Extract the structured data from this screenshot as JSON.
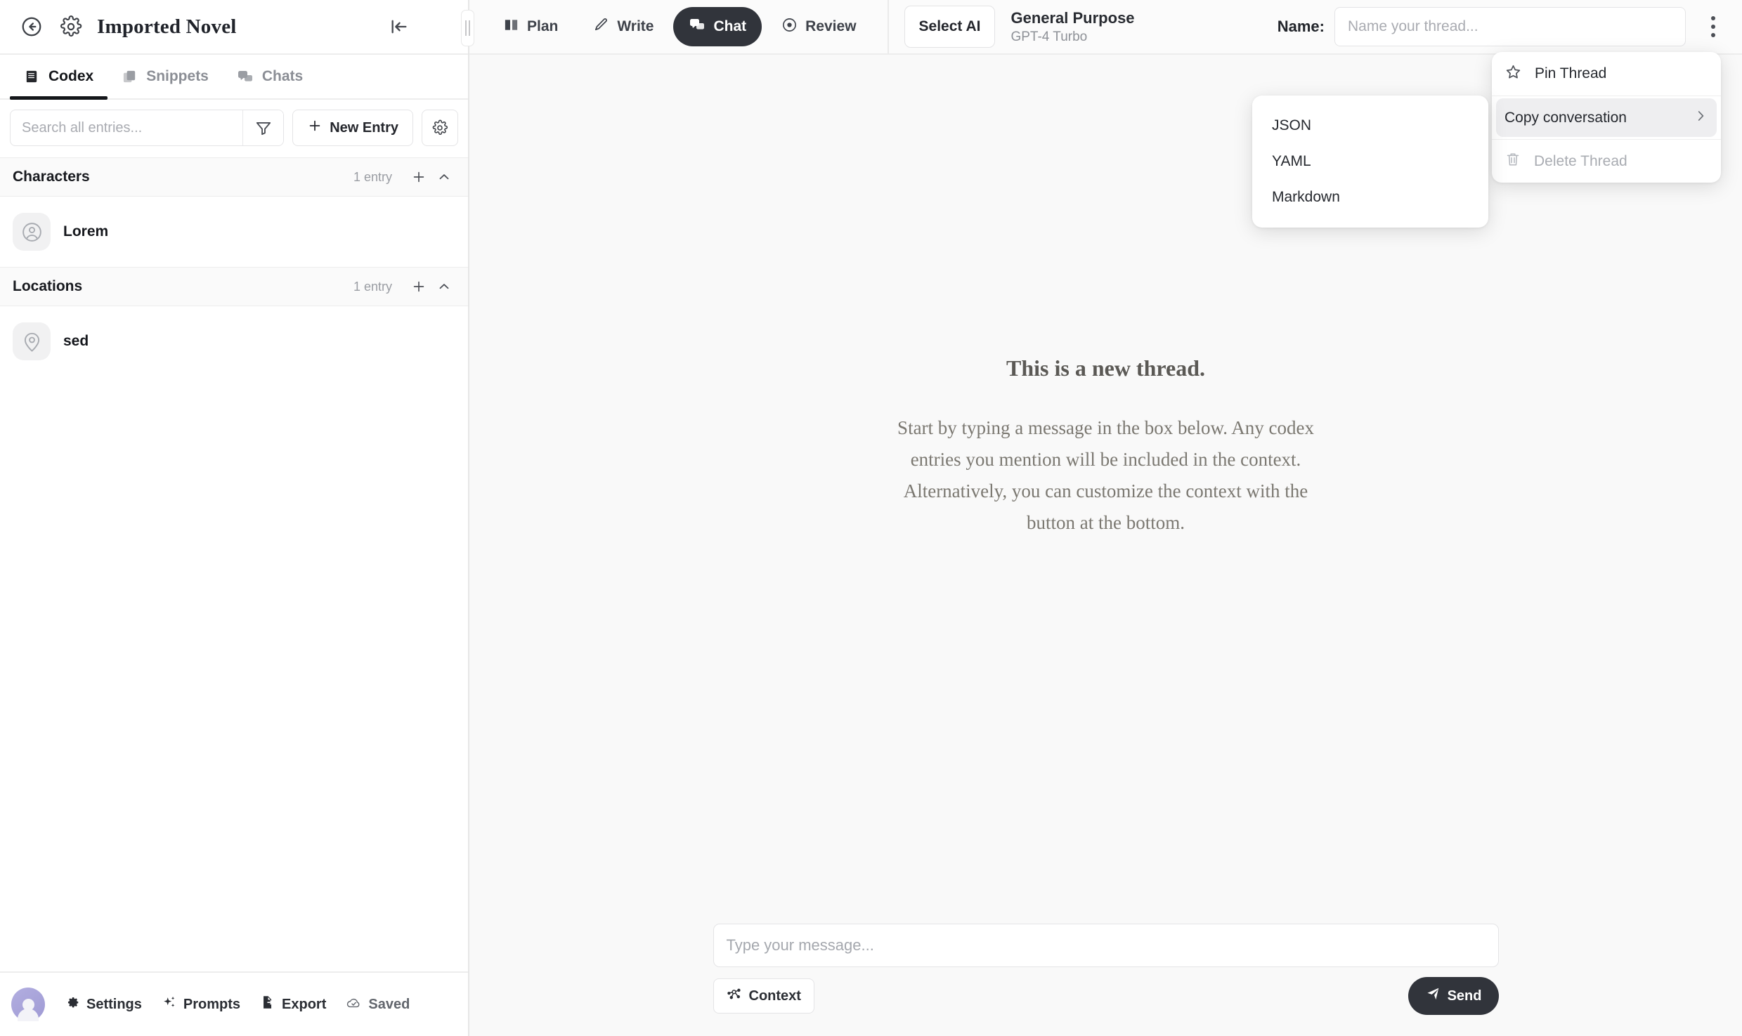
{
  "sidebar": {
    "header": {
      "title": "Imported Novel",
      "back_icon": "back-arrow-icon",
      "settings_icon": "gear-icon",
      "collapse_icon": "collapse-left-icon"
    },
    "tabs": [
      {
        "label": "Codex",
        "icon": "book-icon",
        "active": true
      },
      {
        "label": "Snippets",
        "icon": "copy-icon",
        "active": false
      },
      {
        "label": "Chats",
        "icon": "chat-bubbles-icon",
        "active": false
      }
    ],
    "search": {
      "placeholder": "Search all entries...",
      "value": "",
      "filter_icon": "funnel-icon"
    },
    "new_entry_label": "New Entry",
    "settings_icon": "gear-icon",
    "groups": [
      {
        "name": "Characters",
        "count": "1 entry",
        "entries": [
          {
            "name": "Lorem",
            "icon": "user-circle-icon"
          }
        ]
      },
      {
        "name": "Locations",
        "count": "1 entry",
        "entries": [
          {
            "name": "sed",
            "icon": "map-pin-icon"
          }
        ]
      }
    ],
    "footer": [
      {
        "label": "Settings",
        "icon": "gear-icon"
      },
      {
        "label": "Prompts",
        "icon": "sparkles-icon"
      },
      {
        "label": "Export",
        "icon": "file-export-icon"
      },
      {
        "label": "Saved",
        "icon": "cloud-check-icon"
      }
    ]
  },
  "topbar": {
    "modes": [
      {
        "label": "Plan",
        "icon": "book-open-icon",
        "active": false
      },
      {
        "label": "Write",
        "icon": "pencil-icon",
        "active": false
      },
      {
        "label": "Chat",
        "icon": "chat-bubbles-icon",
        "active": true
      },
      {
        "label": "Review",
        "icon": "eye-icon",
        "active": false
      }
    ],
    "select_ai_label": "Select AI",
    "ai_name": "General Purpose",
    "ai_model": "GPT-4 Turbo",
    "name_label": "Name:",
    "name_placeholder": "Name your thread...",
    "name_value": "",
    "kebab_icon": "more-vertical-icon"
  },
  "thread_menu": {
    "items": [
      {
        "label": "Pin Thread",
        "icon": "star-icon",
        "disabled": false,
        "highlighted": false,
        "has_submenu": false
      },
      {
        "label": "Copy conversation",
        "icon": "",
        "disabled": false,
        "highlighted": true,
        "has_submenu": true
      },
      {
        "label": "Delete Thread",
        "icon": "trash-icon",
        "disabled": true,
        "highlighted": false,
        "has_submenu": false
      }
    ],
    "submenu": {
      "items": [
        "JSON",
        "YAML",
        "Markdown"
      ]
    }
  },
  "empty_state": {
    "title": "This is a new thread.",
    "text": "Start by typing a message in the box below. Any codex entries you mention will be included in the context. Alternatively, you can customize the context with the button at the bottom."
  },
  "composer": {
    "placeholder": "Type your message...",
    "value": "",
    "context_label": "Context",
    "context_icon": "network-nodes-icon",
    "send_label": "Send",
    "send_icon": "paper-plane-icon"
  },
  "colors": {
    "accent_dark": "#31343b",
    "sidebar_bg": "#ffffff",
    "main_bg": "#f9f9f9",
    "avatar_gradient_start": "#b2aee0",
    "avatar_gradient_end": "#9f9ad4"
  }
}
